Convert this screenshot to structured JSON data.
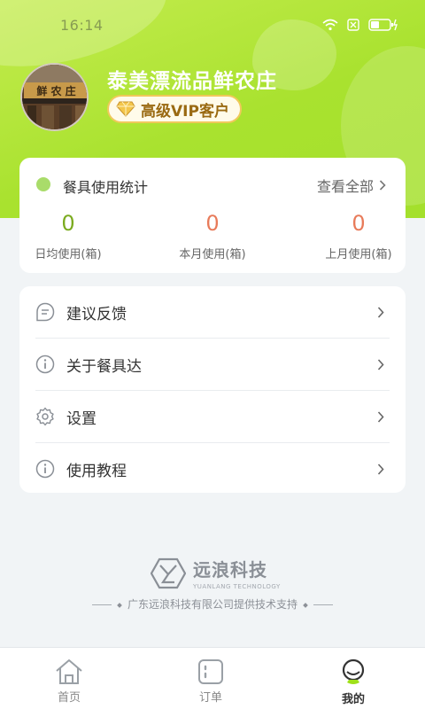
{
  "status_bar": {
    "time": "16:14"
  },
  "profile": {
    "shop_name": "泰美漂流品鲜农庄",
    "vip_label": "高级VIP客户",
    "avatar_sign_text": "鲜 农 庄"
  },
  "stats": {
    "title": "餐具使用统计",
    "view_all": "查看全部",
    "items": [
      {
        "value": "0",
        "label": "日均使用(箱)"
      },
      {
        "value": "0",
        "label": "本月使用(箱)"
      },
      {
        "value": "0",
        "label": "上月使用(箱)"
      }
    ]
  },
  "menu": {
    "items": [
      {
        "label": "建议反馈",
        "icon": "feedback-icon"
      },
      {
        "label": "关于餐具达",
        "icon": "info-icon"
      },
      {
        "label": "设置",
        "icon": "gear-icon"
      },
      {
        "label": "使用教程",
        "icon": "info-icon"
      }
    ]
  },
  "footer": {
    "brand_name": "远浪科技",
    "brand_sub": "YUANLANG TECHNOLOGY",
    "support_text": "广东远浪科技有限公司提供技术支持"
  },
  "tabbar": {
    "tabs": [
      {
        "label": "首页",
        "icon": "home-icon",
        "active": false
      },
      {
        "label": "订单",
        "icon": "order-icon",
        "active": false
      },
      {
        "label": "我的",
        "icon": "profile-icon",
        "active": true
      }
    ]
  },
  "colors": {
    "accent_green": "#a9e22f",
    "vip_gold": "#f0c95a",
    "stat_green": "#7bab1f",
    "stat_orange": "#e87b5a"
  }
}
